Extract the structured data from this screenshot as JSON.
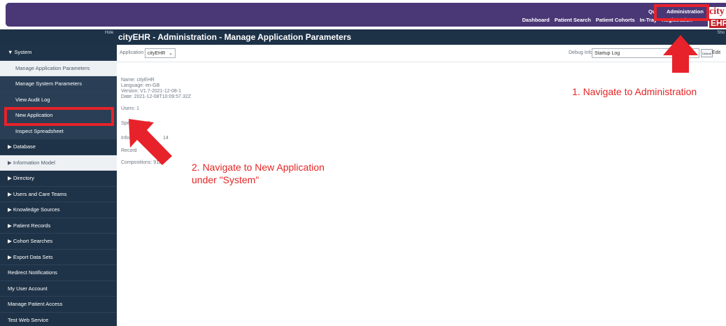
{
  "top_nav": {
    "quick": "Qui",
    "admin": "Administration",
    "items": [
      "Dashboard",
      "Patient Search",
      "Patient Cohorts",
      "In-Tray",
      "Registration"
    ]
  },
  "logo": {
    "line1": "city",
    "line2": "EHR"
  },
  "title_bar": {
    "hide": "Hide",
    "show": "Sho",
    "title": "cityEHR - Administration - Manage Application Parameters"
  },
  "sidebar": {
    "items": [
      {
        "label": "▼ System",
        "kind": "top"
      },
      {
        "label": "Manage Application Parameters",
        "kind": "sub-light"
      },
      {
        "label": "Manage System Parameters",
        "kind": "sub"
      },
      {
        "label": "View Audit Log",
        "kind": "sub"
      },
      {
        "label": "New Application",
        "kind": "sub"
      },
      {
        "label": "Inspect Spreadsheet",
        "kind": "sub"
      },
      {
        "label": "▶ Database",
        "kind": "top"
      },
      {
        "label": "▶ Information Model",
        "kind": "light"
      },
      {
        "label": "▶ Directory",
        "kind": "top"
      },
      {
        "label": "▶ Users and Care Teams",
        "kind": "top"
      },
      {
        "label": "▶ Knowledge Sources",
        "kind": "top"
      },
      {
        "label": "▶ Patient Records",
        "kind": "top"
      },
      {
        "label": "▶ Cohort Searches",
        "kind": "top"
      },
      {
        "label": "▶ Export Data Sets",
        "kind": "top"
      },
      {
        "label": "Redirect Notifications",
        "kind": "top"
      },
      {
        "label": "My User Account",
        "kind": "top"
      },
      {
        "label": "Manage Patient Access",
        "kind": "top"
      },
      {
        "label": "Test Web Service",
        "kind": "top"
      }
    ]
  },
  "toolbar": {
    "application_label": "Application",
    "application_value": "cityEHR",
    "debug_label": "Debug Info:",
    "debug_value": "Startup Log",
    "button": "Default",
    "edit": "Edit"
  },
  "content": {
    "name": "Name: cityEHR",
    "language": "Language: en-GB",
    "version": "Version: V1.7-2021-12-08-1",
    "date": "Date: 2021-12-08T10:09:57.32Z",
    "users": "Users: 1",
    "specialties": "Specialties: 3",
    "information": "Inform",
    "information_tail": "14",
    "records": "Record",
    "compositions": "Compositions: 911"
  },
  "annotations": {
    "step1": "1. Navigate to Administration",
    "step2_line1": "2. Navigate to New Application",
    "step2_line2": "under \"System\""
  },
  "colors": {
    "header": "#4a3776",
    "title_bar": "#1d3147",
    "sidebar": "#1f3348",
    "annotation": "#e8222a"
  }
}
